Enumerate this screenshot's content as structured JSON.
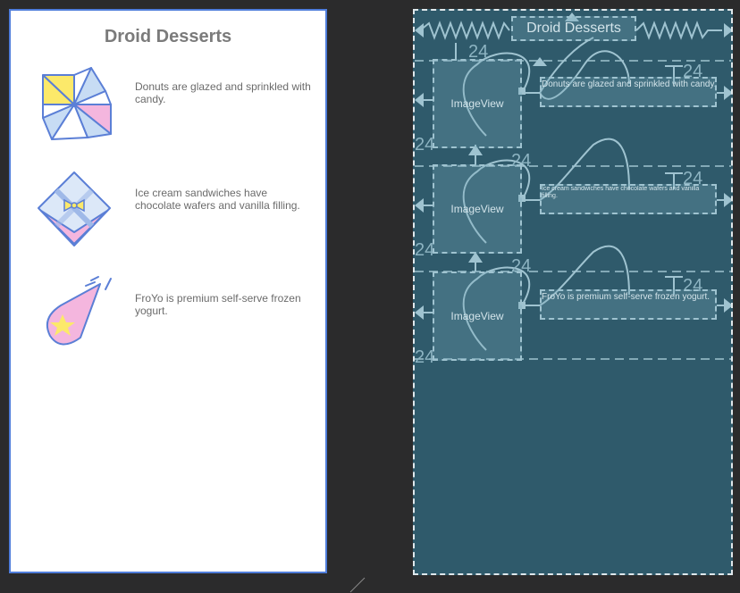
{
  "design": {
    "title": "Droid Desserts",
    "items": [
      {
        "text": "Donuts are glazed and sprinkled with candy.",
        "icon": "pinwheel-icon"
      },
      {
        "text": "Ice cream sandwiches have chocolate wafers and vanilla filling.",
        "icon": "ice-cream-sandwich-icon"
      },
      {
        "text": "FroYo is premium self-serve frozen yogurt.",
        "icon": "froyo-icon"
      }
    ]
  },
  "blueprint": {
    "title": "Droid Desserts",
    "image_label": "ImageView",
    "texts": [
      "Donuts are glazed and sprinkled with candy.",
      "Ice cream sandwiches have chocolate wafers and vanilla filling.",
      "FroYo is premium self-serve frozen yogurt."
    ],
    "margin": "24"
  },
  "colors": {
    "canvas_bg": "#2b2b2c",
    "design_border": "#4f7ddb",
    "blueprint_bg": "#2f5a6b",
    "blueprint_line": "#9fc3d0",
    "text_gray": "#6b6b6b"
  }
}
